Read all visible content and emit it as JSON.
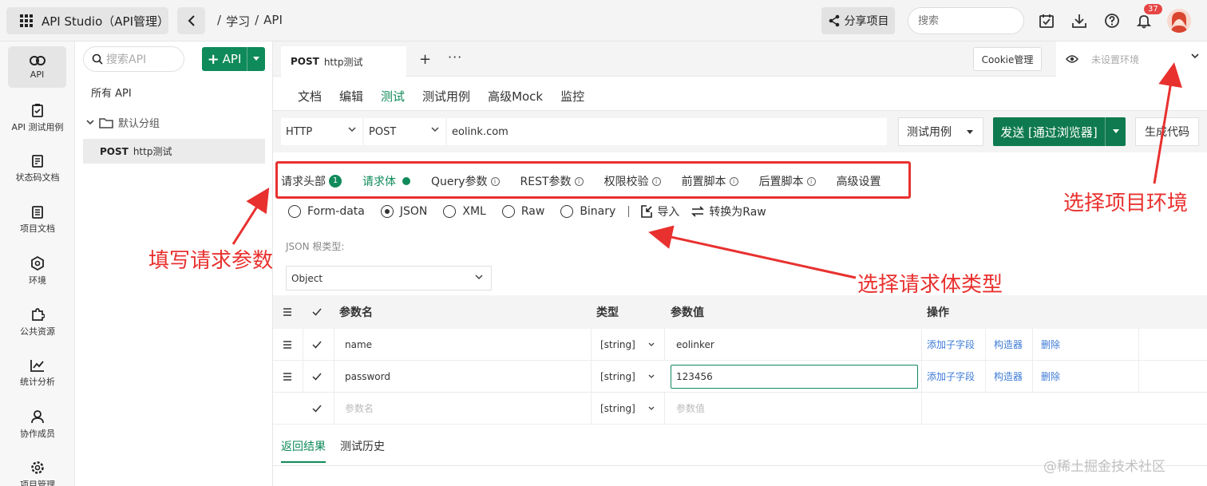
{
  "app": {
    "title": "API Studio（API管理）"
  },
  "breadcrumb": [
    "/",
    "学习",
    "/",
    "API"
  ],
  "topbar": {
    "share_label": "分享项目",
    "search_placeholder": "搜索",
    "notification_count": "37",
    "icons": [
      "calendar-check-icon",
      "download-icon",
      "help-icon",
      "bell-icon",
      "avatar"
    ]
  },
  "rail": [
    {
      "label": "API",
      "icon": "link-icon",
      "active": true
    },
    {
      "label": "API 测试用例",
      "icon": "clipboard-icon"
    },
    {
      "label": "状态码文档",
      "icon": "document-icon"
    },
    {
      "label": "项目文档",
      "icon": "file-icon"
    },
    {
      "label": "环境",
      "icon": "environment-icon"
    },
    {
      "label": "公共资源",
      "icon": "puzzle-icon"
    },
    {
      "label": "统计分析",
      "icon": "chart-icon"
    },
    {
      "label": "协作成员",
      "icon": "users-icon"
    },
    {
      "label": "项目管理",
      "icon": "settings-icon"
    }
  ],
  "tree": {
    "search_placeholder": "搜索API",
    "add_label": "API",
    "all_label": "所有 API",
    "group_label": "默认分组",
    "api": {
      "method": "POST",
      "name": "http测试"
    }
  },
  "tab": {
    "method": "POST",
    "name": "http测试",
    "plus": "+",
    "more": "···"
  },
  "cookie_label": "Cookie管理",
  "env_placeholder": "未设置环境",
  "subnav": [
    {
      "label": "文档"
    },
    {
      "label": "编辑"
    },
    {
      "label": "测试",
      "active": true
    },
    {
      "label": "测试用例"
    },
    {
      "label": "高级Mock"
    },
    {
      "label": "监控"
    }
  ],
  "request": {
    "protocol": "HTTP",
    "method": "POST",
    "url": "eolink.com",
    "case_label": "测试用例",
    "send_label": "发送 [通过浏览器]",
    "gen_label": "生成代码"
  },
  "req_tabs": [
    {
      "label": "请求头部",
      "badge": "1"
    },
    {
      "label": "请求体",
      "active": true
    },
    {
      "label": "Query参数",
      "info": true
    },
    {
      "label": "REST参数",
      "info": true
    },
    {
      "label": "权限校验",
      "info": true
    },
    {
      "label": "前置脚本",
      "info": true
    },
    {
      "label": "后置脚本",
      "info": true
    },
    {
      "label": "高级设置"
    }
  ],
  "body_types": [
    {
      "label": "Form-data",
      "selected": false
    },
    {
      "label": "JSON",
      "selected": true
    },
    {
      "label": "XML",
      "selected": false
    },
    {
      "label": "Raw",
      "selected": false
    },
    {
      "label": "Binary",
      "selected": false
    }
  ],
  "tools": {
    "import_label": "导入",
    "convert_label": "转换为Raw",
    "separator": "|"
  },
  "json_root": {
    "label": "JSON 根类型:",
    "value": "Object"
  },
  "table": {
    "headers": {
      "name": "参数名",
      "type": "类型",
      "value": "参数值",
      "ops": "操作"
    },
    "rows": [
      {
        "name": "name",
        "type": "[string]",
        "value": "eolinker",
        "ops": [
          "添加子字段",
          "构造器",
          "删除"
        ]
      },
      {
        "name": "password",
        "type": "[string]",
        "value": "123456",
        "ops": [
          "添加子字段",
          "构造器",
          "删除"
        ]
      },
      {
        "name_placeholder": "参数名",
        "type": "[string]",
        "value_placeholder": "参数值"
      }
    ]
  },
  "result_tabs": [
    {
      "label": "返回结果",
      "active": true
    },
    {
      "label": "测试历史"
    }
  ],
  "watermark": "@稀土掘金技术社区",
  "annotations": {
    "fill_params": "填写请求参数",
    "select_body": "选择请求体类型",
    "select_env": "选择项目环境",
    "color": "#e8312f"
  },
  "colors": {
    "accent": "#0f8a5a",
    "link": "#3d7bd6",
    "annotation": "#e8312f"
  }
}
